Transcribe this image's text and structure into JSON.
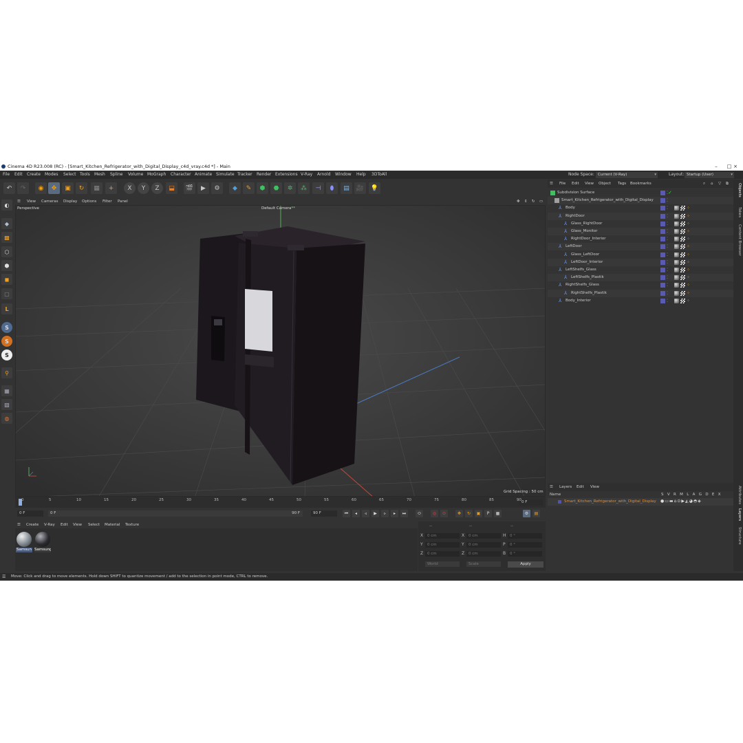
{
  "window": {
    "title": "Cinema 4D R23.008 (RC) - [Smart_Kitchen_Refrigerator_with_Digital_Display_c4d_vray.c4d *] - Main",
    "minimize": "–",
    "maximize": "□",
    "close": "×"
  },
  "menubar": {
    "items": [
      "File",
      "Edit",
      "Create",
      "Modes",
      "Select",
      "Tools",
      "Mesh",
      "Spline",
      "Volume",
      "MoGraph",
      "Character",
      "Animate",
      "Simulate",
      "Tracker",
      "Render",
      "Extensions",
      "V-Ray",
      "Arnold",
      "Window",
      "Help",
      "3DToAll"
    ],
    "node_space_label": "Node Space:",
    "node_space_value": "Current (V-Ray)",
    "layout_label": "Layout:",
    "layout_value": "Startup (User)"
  },
  "viewport_menu": {
    "items": [
      "View",
      "Cameras",
      "Display",
      "Options",
      "Filter",
      "Panel"
    ],
    "view_name": "Perspective",
    "camera": "Default Camera",
    "camera_suffix": "**",
    "grid_spacing": "Grid Spacing : 50 cm"
  },
  "timeline": {
    "ticks": [
      "0",
      "5",
      "10",
      "15",
      "20",
      "25",
      "30",
      "35",
      "40",
      "45",
      "50",
      "55",
      "60",
      "65",
      "70",
      "75",
      "80",
      "85",
      "90"
    ],
    "end_field": "0 F",
    "start_frame": "0 F",
    "current_frame": "0 F",
    "end_frame_a": "90 F",
    "end_frame_b": "90 F"
  },
  "material_panel": {
    "menu": [
      "Create",
      "V-Ray",
      "Edit",
      "View",
      "Select",
      "Material",
      "Texture"
    ],
    "materials": [
      {
        "name": "Samsun"
      },
      {
        "name": "Samsung"
      }
    ]
  },
  "coordinates": {
    "header_dashes": [
      "--",
      "--",
      "--"
    ],
    "rows": [
      {
        "a": "X",
        "a_val": "0 cm",
        "b": "X",
        "b_val": "0 cm",
        "c": "H",
        "c_val": "0 °"
      },
      {
        "a": "Y",
        "a_val": "0 cm",
        "b": "Y",
        "b_val": "0 cm",
        "c": "P",
        "c_val": "0 °"
      },
      {
        "a": "Z",
        "a_val": "0 cm",
        "b": "Z",
        "b_val": "0 cm",
        "c": "B",
        "c_val": "0 °"
      }
    ],
    "space": "World",
    "mode": "Scale",
    "apply": "Apply"
  },
  "objects_panel": {
    "menu": [
      "File",
      "Edit",
      "View",
      "Object",
      "Tags",
      "Bookmarks"
    ],
    "rows": [
      {
        "name": "Subdivision Surface",
        "depth": 0
      },
      {
        "name": "Smart_Kitchen_Refrigerator_with_Digital_Display",
        "depth": 1
      },
      {
        "name": "Body",
        "depth": 2
      },
      {
        "name": "RightDoor",
        "depth": 2
      },
      {
        "name": "Glass_RightDoor",
        "depth": 3
      },
      {
        "name": "Glass_Monitor",
        "depth": 3
      },
      {
        "name": "RightDoor_Interior",
        "depth": 3
      },
      {
        "name": "LeftDoor",
        "depth": 2
      },
      {
        "name": "Glass_LeftDoor",
        "depth": 3
      },
      {
        "name": "LeftDoor_Interior",
        "depth": 3
      },
      {
        "name": "LeftShelfs_Glass",
        "depth": 2
      },
      {
        "name": "LeftShelfs_Plastik",
        "depth": 3
      },
      {
        "name": "RightShelfs_Glass",
        "depth": 2
      },
      {
        "name": "RightShelfs_Plastik",
        "depth": 3
      },
      {
        "name": "Body_Interior",
        "depth": 2
      }
    ]
  },
  "layers_panel": {
    "menu": [
      "Layers",
      "Edit",
      "View"
    ],
    "name_header": "Name",
    "columns": "S V R M L A G D E X",
    "layer_name": "Smart_Kitchen_Refrigerator_with_Digital_Display"
  },
  "side_tabs": [
    "Objects",
    "Takes",
    "Content Browser",
    "Attributes",
    "Layers",
    "Structure"
  ],
  "status": "Move: Click and drag to move elements. Hold down SHIFT to quantize movement / add to the selection in point mode, CTRL to remove.",
  "colors": {
    "accent": "#5a6b80",
    "layer_text": "#e0903a",
    "background": "#333333"
  }
}
